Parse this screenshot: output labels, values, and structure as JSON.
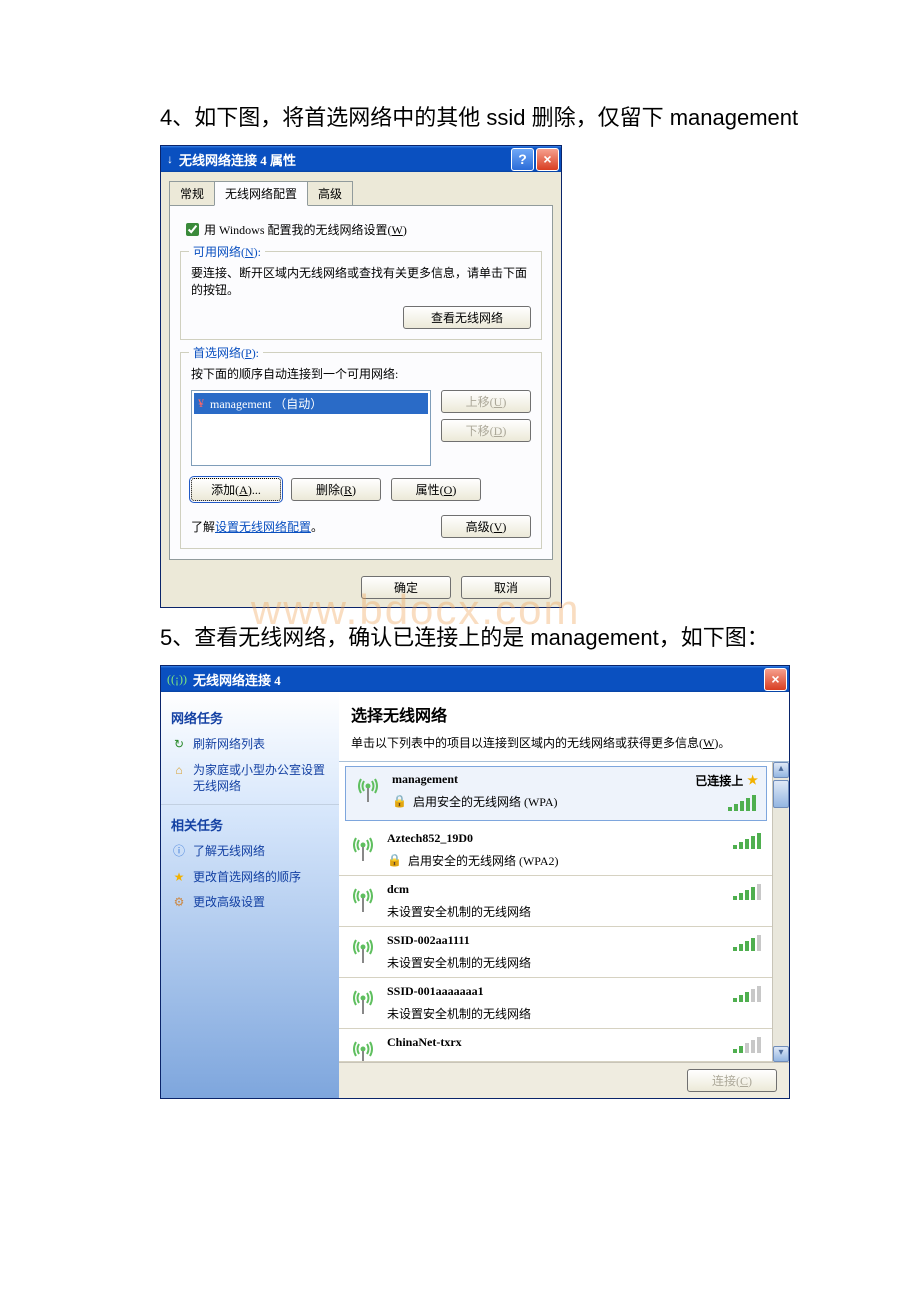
{
  "line1": "4、如下图，将首选网络中的其他 ssid 删除，仅留下 management",
  "line2": "5、查看无线网络，确认已连接上的是 management，如下图：",
  "watermark": "www.bdocx.com",
  "dlg1": {
    "icon": "↓",
    "title": "无线网络连接 4 属性",
    "help": "?",
    "close": "×",
    "tabs": {
      "general": "常规",
      "wireless": "无线网络配置",
      "advanced": "高级"
    },
    "chk_label_pre": "用 Windows 配置我的无线网络设置(",
    "chk_key": "W",
    "chk_label_post": ")",
    "group_avail": {
      "legend_pre": "可用网络(",
      "legend_key": "N",
      "legend_post": "):",
      "text": "要连接、断开区域内无线网络或查找有关更多信息，请单击下面的按钮。",
      "btn": "查看无线网络"
    },
    "group_pref": {
      "legend_pre": "首选网络(",
      "legend_key": "P",
      "legend_post": "):",
      "text": "按下面的顺序自动连接到一个可用网络:",
      "item": "management （自动）",
      "btn_up_pre": "上移(",
      "btn_up_key": "U",
      "btn_up_post": ")",
      "btn_down_pre": "下移(",
      "btn_down_key": "D",
      "btn_down_post": ")",
      "btn_add_pre": "添加(",
      "btn_add_key": "A",
      "btn_add_post": ")...",
      "btn_del_pre": "删除(",
      "btn_del_key": "R",
      "btn_del_post": ")",
      "btn_prop_pre": "属性(",
      "btn_prop_key": "O",
      "btn_prop_post": ")"
    },
    "learn_pre": "了解",
    "learn_link": "设置无线网络配置",
    "learn_post": "。",
    "btn_adv_pre": "高级(",
    "btn_adv_key": "V",
    "btn_adv_post": ")",
    "ok": "确定",
    "cancel": "取消"
  },
  "dlg2": {
    "title": "无线网络连接 4",
    "side": {
      "hdr1": "网络任务",
      "links1": {
        "refresh": "刷新网络列表",
        "setup": "为家庭或小型办公室设置无线网络"
      },
      "hdr2": "相关任务",
      "links2": {
        "learn": "了解无线网络",
        "order": "更改首选网络的顺序",
        "adv": "更改高级设置"
      }
    },
    "main": {
      "title": "选择无线网络",
      "sub_pre": "单击以下列表中的项目以连接到区域内的无线网络或获得更多信息(",
      "sub_key": "W",
      "sub_post": ")。",
      "connected": "已连接上",
      "connect_btn_pre": "连接(",
      "connect_btn_key": "C",
      "connect_btn_post": ")"
    },
    "nets": [
      {
        "name": "management",
        "sub": "启用安全的无线网络 (WPA)",
        "lock": true,
        "sel": true,
        "connected": true,
        "strength": 5
      },
      {
        "name": "Aztech852_19D0",
        "sub": "启用安全的无线网络 (WPA2)",
        "lock": true,
        "strength": 5
      },
      {
        "name": "dcm",
        "sub": "未设置安全机制的无线网络",
        "lock": false,
        "strength": 4
      },
      {
        "name": "SSID-002aa1111",
        "sub": "未设置安全机制的无线网络",
        "lock": false,
        "strength": 4
      },
      {
        "name": "SSID-001aaaaaaa1",
        "sub": "未设置安全机制的无线网络",
        "lock": false,
        "strength": 3
      },
      {
        "name": "ChinaNet-txrx",
        "sub": "",
        "lock": false,
        "strength": 2,
        "partial": true
      }
    ]
  }
}
